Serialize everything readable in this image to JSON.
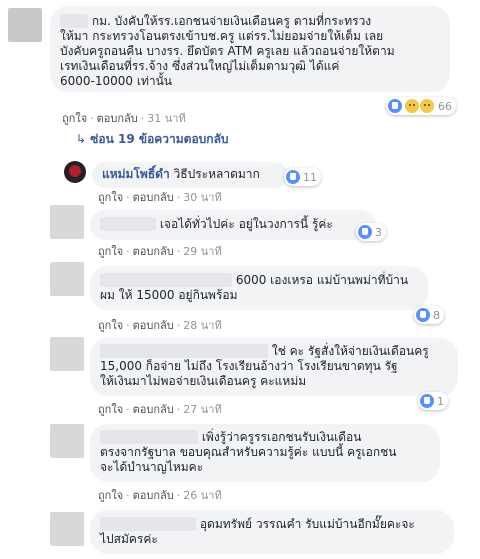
{
  "main_comment": {
    "text_lines": [
      "กม. บังคับให้รร.เอกชนจ่ายเงินเดือนครู ตามที่กระทรวง",
      "ให้มา กระทรวงโอนตรงเข้าบช.ครู แต่รร.ไม่ยอมจ่ายให้เต็ม เลย",
      "บังคับครูถอนคืน บางรร. ยึดบัตร ATM ครูเลย แล้วถอนจ่ายให้ตาม",
      "เรทเงินเดือนที่รร.จ้าง ซึ่งส่วนใหญ่ไม่เต็มตามวุฒิ ได้แค่",
      "6000-10000 เท่านั้น"
    ],
    "like_label": "ถูกใจ",
    "reply_label": "ตอบกลับ",
    "time": "31 นาที",
    "reactions_count": "66"
  },
  "replies_toggle": "ซ่อน 19 ข้อความตอบกลับ",
  "replies": [
    {
      "name": "แหม่มโพธิ์ดำ",
      "text_lines": [
        "วิธีประหลาดมาก"
      ],
      "like_label": "ถูกใจ",
      "reply_label": "ตอบกลับ",
      "time": "30 นาที",
      "reactions_count": "11"
    },
    {
      "text_lines": [
        "เจอได้ทั่วไปค่ะ อยู่ในวงการนี้ รู้ค่ะ"
      ],
      "like_label": "ถูกใจ",
      "reply_label": "ตอบกลับ",
      "time": "29 นาที",
      "reactions_count": "3"
    },
    {
      "text_lines": [
        "6000 เองเหรอ แม่บ้านพม่าที่บ้าน",
        "ผม ให้ 15000 อยู่กินพร้อม"
      ],
      "like_label": "ถูกใจ",
      "reply_label": "ตอบกลับ",
      "time": "28 นาที",
      "reactions_count": "8"
    },
    {
      "text_lines": [
        "ใช่ คะ รัฐสั่งให้จ่ายเงินเดือนครู",
        "15,000 ก็อจ่าย ไม่ถึง โรงเรียนอ้างว่า โรงเรียนขาดทุน รัฐ",
        "ให้เงินมาไม่พอจ่ายเงินเดือนครู คะแหม่ม"
      ],
      "like_label": "ถูกใจ",
      "reply_label": "ตอบกลับ",
      "time": "27 นาที",
      "reactions_count": "1"
    },
    {
      "text_lines": [
        "เพิ่งรู้ว่าครูรรเอกชนรับเงินเดือน",
        "ตรงจากรัฐบาล ขอบคุณสำหรับความรู้ค่ะ แบบนี้ ครูเอกชน",
        "จะได้บำนาญไหมคะ"
      ],
      "like_label": "ถูกใจ",
      "reply_label": "ตอบกลับ",
      "time": "26 นาที"
    },
    {
      "text_lines": [
        "อุดมทรัพย์ วรรณคำ รับแม่บ้านอีกมั๊ยคะจะ",
        "ไปสมัครค่ะ"
      ]
    }
  ],
  "colors": {
    "link": "#385898",
    "like": "#5890ff",
    "bubble": "#f2f3f5"
  }
}
